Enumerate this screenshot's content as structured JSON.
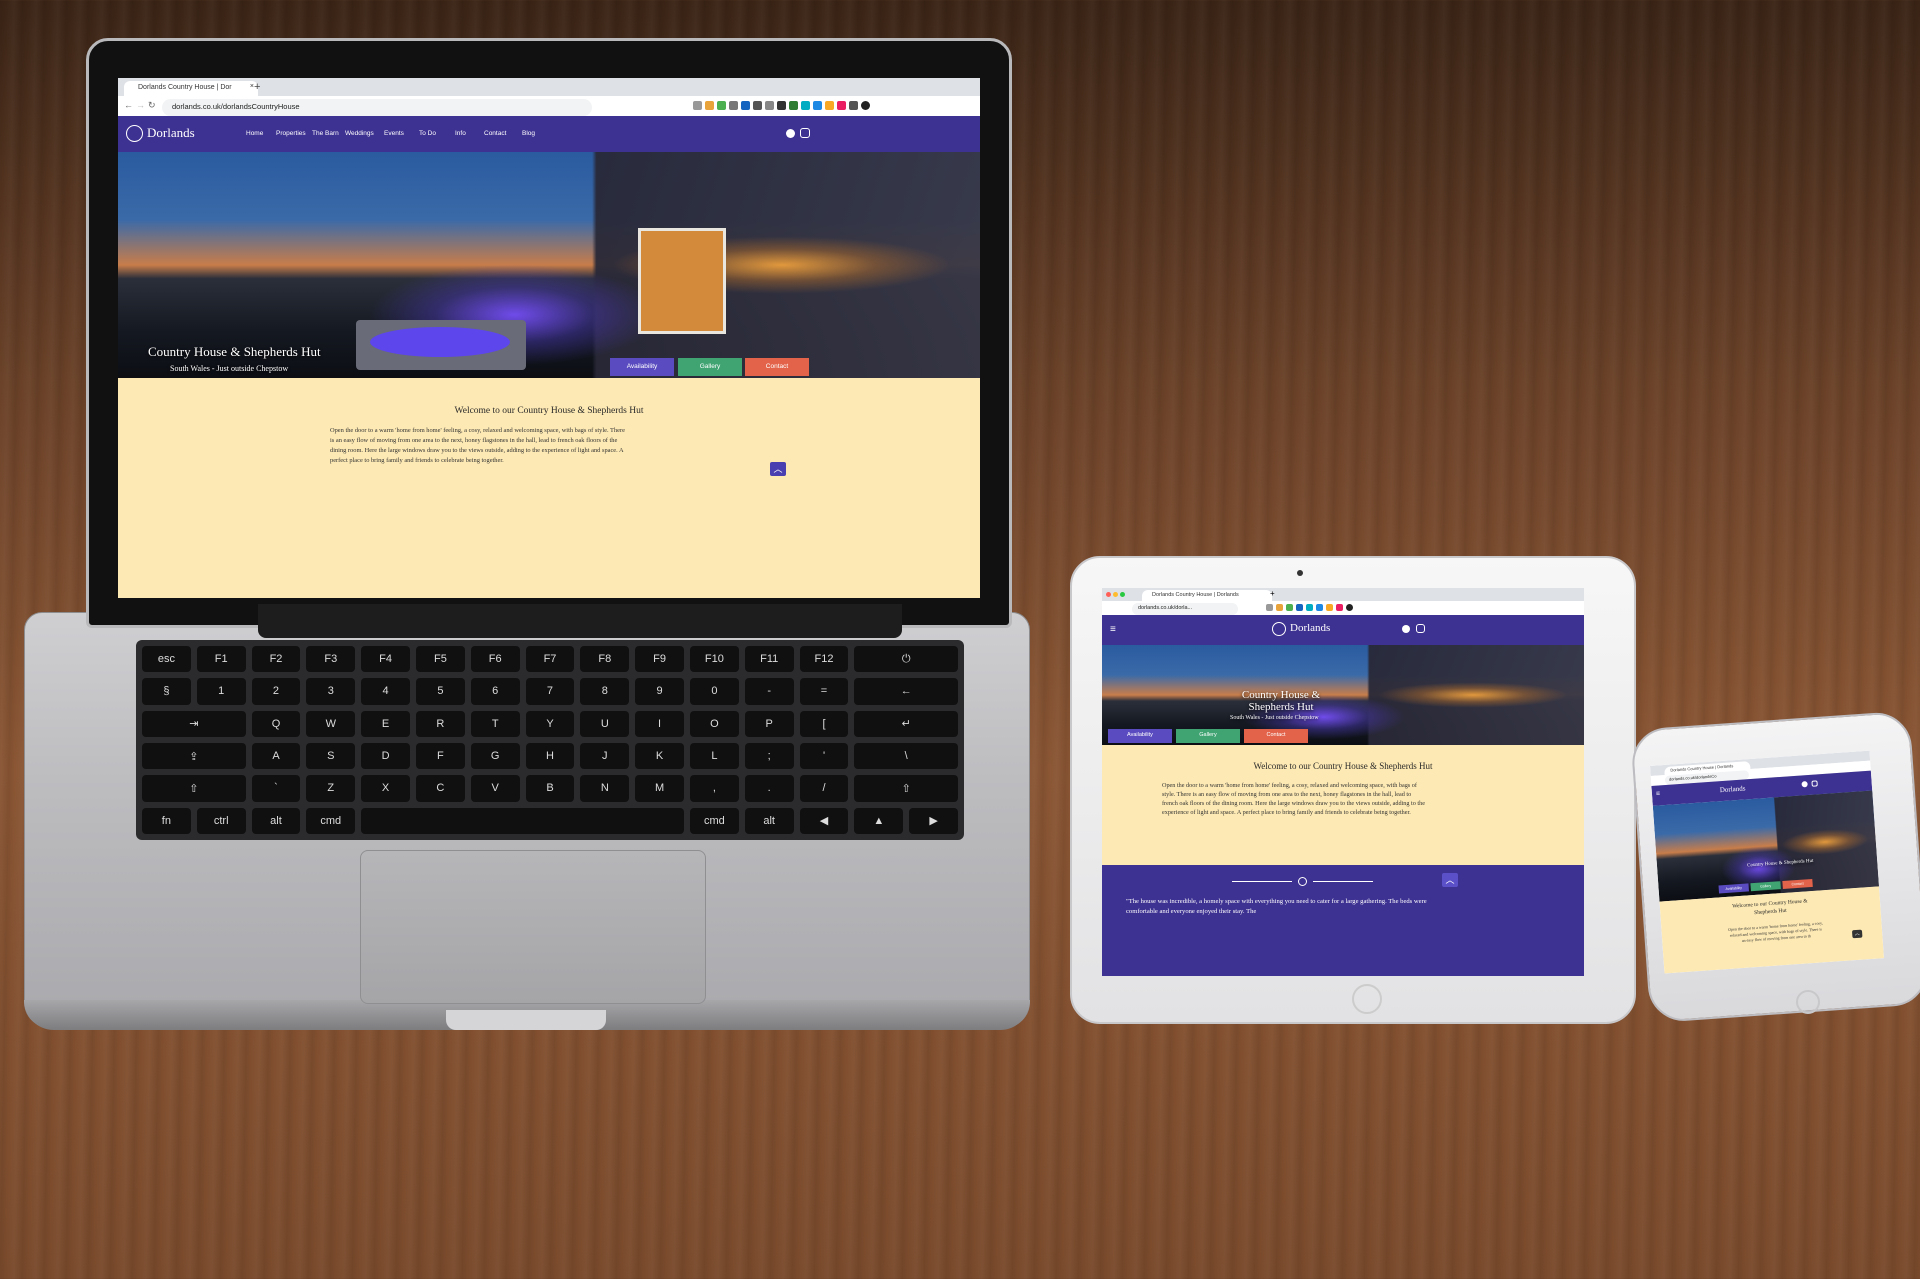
{
  "browser": {
    "tab_title": "Dorlands Country House | Dorlands",
    "tab_title_short": "Dorlands Country House | Dor",
    "new_tab_icon": "plus-icon",
    "url": "dorlands.co.uk/dorlandsCountryHouse",
    "url_tablet": "dorlands.co.uk/dorla...",
    "url_phone": "dorlands.co.uk/dorlandsCo"
  },
  "site": {
    "brand": "Dorlands",
    "nav": [
      "Home",
      "Properties",
      "The Barn",
      "Weddings",
      "Events",
      "To Do",
      "Info",
      "Contact",
      "Blog"
    ],
    "social_icons": [
      "facebook-icon",
      "instagram-icon"
    ],
    "hero_title": "Country House & Shepherds Hut",
    "hero_title_line1": "Country House &",
    "hero_title_line2": "Shepherds Hut",
    "hero_subtitle": "South Wales - Just outside Chepstow",
    "buttons": {
      "availability": "Availability",
      "gallery": "Gallery",
      "contact": "Contact"
    },
    "welcome_title": "Welcome to our Country House & Shepherds Hut",
    "phone_welcome_line1": "Welcome to our Country House &",
    "phone_welcome_line2": "Shepherds Hut",
    "intro": "Open the door to a warm 'home from home' feeling, a cosy, relaxed and welcoming space, with bags of style. There is an easy flow of moving from one area to the next, honey flagstones in the hall, lead to french oak floors of the dining room. Here the large windows draw you to the views outside, adding to the experience of light and space. A perfect place to bring family and friends to celebrate being together.",
    "phone_intro": "Open the door to a warm 'home from home' feeling, a cosy, relaxed and welcoming space, with bags of style. There is an easy flow of moving from one area to th",
    "testimonial": "\"The house was incredible, a homely space with everything you need to cater for a large gathering. The beds were comfortable and everyone enjoyed their stay. The",
    "scroll_up_icon": "chevron-up-icon",
    "menu_icon": "hamburger-icon"
  },
  "colors": {
    "nav": "#3d3192",
    "cream": "#fde9b3",
    "availability": "#5a4cc0",
    "gallery": "#3fa372",
    "contact": "#e2634a"
  }
}
